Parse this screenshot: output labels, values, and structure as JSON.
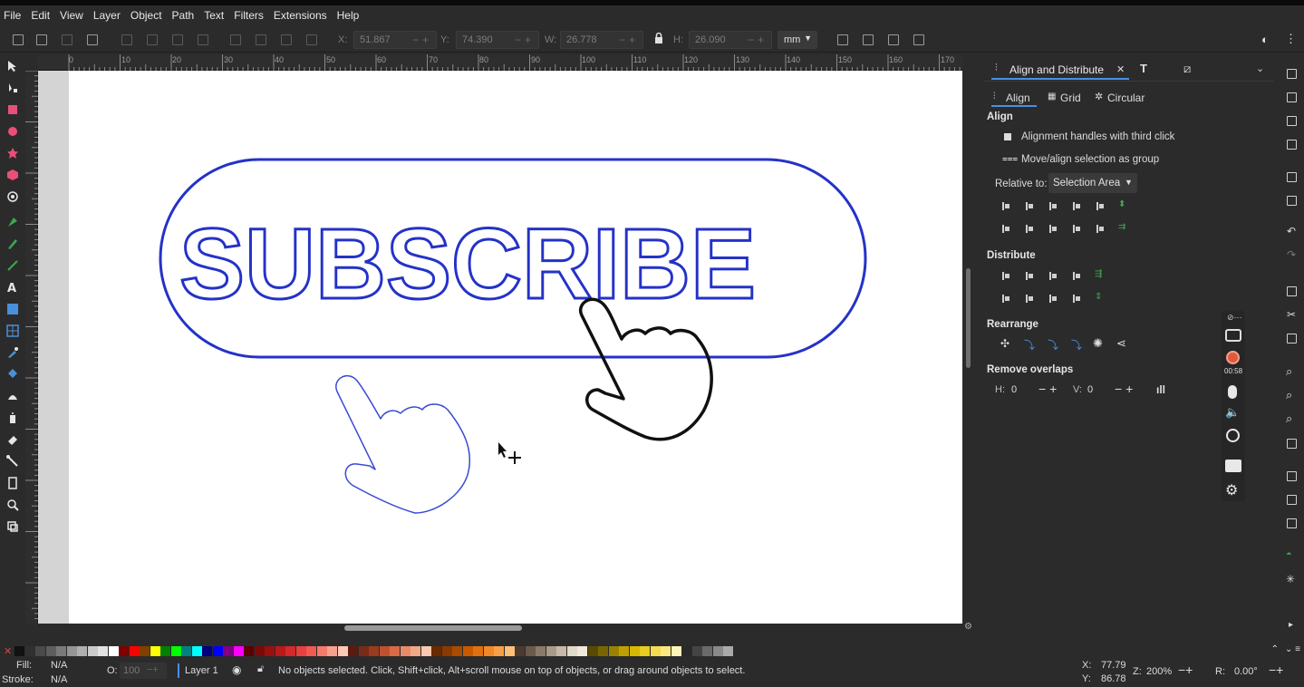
{
  "menu": [
    "File",
    "Edit",
    "View",
    "Layer",
    "Object",
    "Path",
    "Text",
    "Filters",
    "Extensions",
    "Help"
  ],
  "toolbar": {
    "x_label": "X:",
    "x_value": "51.867",
    "y_label": "Y:",
    "y_value": "74.390",
    "w_label": "W:",
    "w_value": "26.778",
    "h_label": "H:",
    "h_value": "26.090",
    "unit": "mm"
  },
  "ruler_top": [
    "0",
    "10",
    "20",
    "30",
    "40",
    "50",
    "60",
    "70",
    "80",
    "90",
    "100",
    "110",
    "120",
    "130",
    "140",
    "150",
    "160",
    "170"
  ],
  "canvas": {
    "headline": "SUBSCRIBE",
    "button_stroke": "#2432c8",
    "text_stroke": "#2432c8",
    "hand1_stroke": "#111111",
    "hand2_stroke": "#3a4ad4"
  },
  "dock": {
    "tabs": [
      "Align and Distribute"
    ],
    "subtabs": [
      "Align",
      "Grid",
      "Circular"
    ],
    "align_title": "Align",
    "opt1": "Alignment handles with third click",
    "opt2": "Move/align selection as group",
    "relative_label": "Relative to:",
    "relative_value": "Selection Area",
    "distribute_title": "Distribute",
    "rearrange_title": "Rearrange",
    "overlap_title": "Remove overlaps",
    "h_label": "H:",
    "h_value": "0",
    "v_label": "V:",
    "v_value": "0"
  },
  "recorder": {
    "timer": "00:58"
  },
  "palette": [
    "#111111",
    "#303030",
    "#4a4a4a",
    "#5e5e5e",
    "#7a7a7a",
    "#959595",
    "#b0b0b0",
    "#cacaca",
    "#e2e2e2",
    "#ffffff",
    "#800000",
    "#ff0000",
    "#804000",
    "#ffff00",
    "#008000",
    "#00ff00",
    "#008080",
    "#00ffff",
    "#000080",
    "#0000ff",
    "#800080",
    "#ff00ff",
    "#5a0000",
    "#7a0a0a",
    "#9a1010",
    "#b81a1a",
    "#d42a2a",
    "#e84040",
    "#f05a50",
    "#f47a6a",
    "#f8a090",
    "#fcc8b8",
    "#5a1a10",
    "#7a2a18",
    "#9a3a20",
    "#c05030",
    "#d86a48",
    "#e88a68",
    "#f0a888",
    "#f8c8b0",
    "#6a2a00",
    "#8a3a00",
    "#aa4a00",
    "#c85a00",
    "#e07010",
    "#f08828",
    "#f8a048",
    "#fcc078",
    "#4a3a30",
    "#6a5a4a",
    "#8a7a6a",
    "#aa9a88",
    "#c8b8a8",
    "#e0d8c8",
    "#f0e8dc",
    "#5a4a00",
    "#7a6600",
    "#9a8200",
    "#c0a000",
    "#d8b800",
    "#e8cc20",
    "#f4dc50",
    "#f8e880",
    "#fcf4b8",
    "#2a2a2a",
    "#444444",
    "#6a6a6a",
    "#8a8a8a",
    "#aaaaaa"
  ],
  "status": {
    "fill_label": "Fill:",
    "fill_value": "N/A",
    "stroke_label": "Stroke:",
    "stroke_value": "N/A",
    "opacity_label": "O:",
    "opacity_value": "100",
    "layer": "Layer 1",
    "message": "No objects selected. Click, Shift+click, Alt+scroll mouse on top of objects, or drag around objects to select.",
    "x_label": "X:",
    "x_value": "77.79",
    "y_label": "Y:",
    "y_value": "86.78",
    "zoom_label": "Z:",
    "zoom_value": "200%",
    "rot_label": "R:",
    "rot_value": "0.00°"
  }
}
